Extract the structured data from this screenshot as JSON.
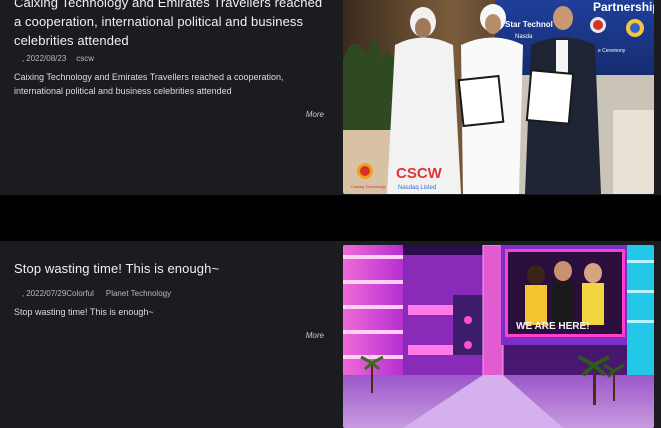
{
  "articles": [
    {
      "title": "Caixing Technology and Emirates Travellers reached a cooperation, international political and business celebrities attended",
      "date": "2022/08/23",
      "author": "cscw",
      "summary": "Caixing Technology and Emirates Travellers reached a cooperation, international political and business celebrities attended",
      "more_label": "More",
      "image": {
        "banner_text": "Partnership",
        "banner_sub": "Star Technol",
        "banner_sub2": "Nasda",
        "ceremony_text": "e Ceremony",
        "logo_text": "CSCW",
        "logo_sub": "Nasdaq Listed",
        "left_logo_text": "Caixing Technology"
      }
    },
    {
      "title": "Stop wasting time! This is enough~",
      "date": "2022/07/29",
      "author": "Colorful Planet Technology",
      "author_part1": "Colorful",
      "author_part2": "Planet Technology",
      "summary": "Stop wasting time! This is enough~",
      "more_label": "More",
      "image": {
        "billboard_text": "WE ARE HERE!"
      }
    }
  ],
  "colors": {
    "card_bg": "#1b1c1f",
    "page_bg": "#000000",
    "billboard_pink": "#ff3fcf",
    "billboard_purple": "#7a2bd6"
  }
}
